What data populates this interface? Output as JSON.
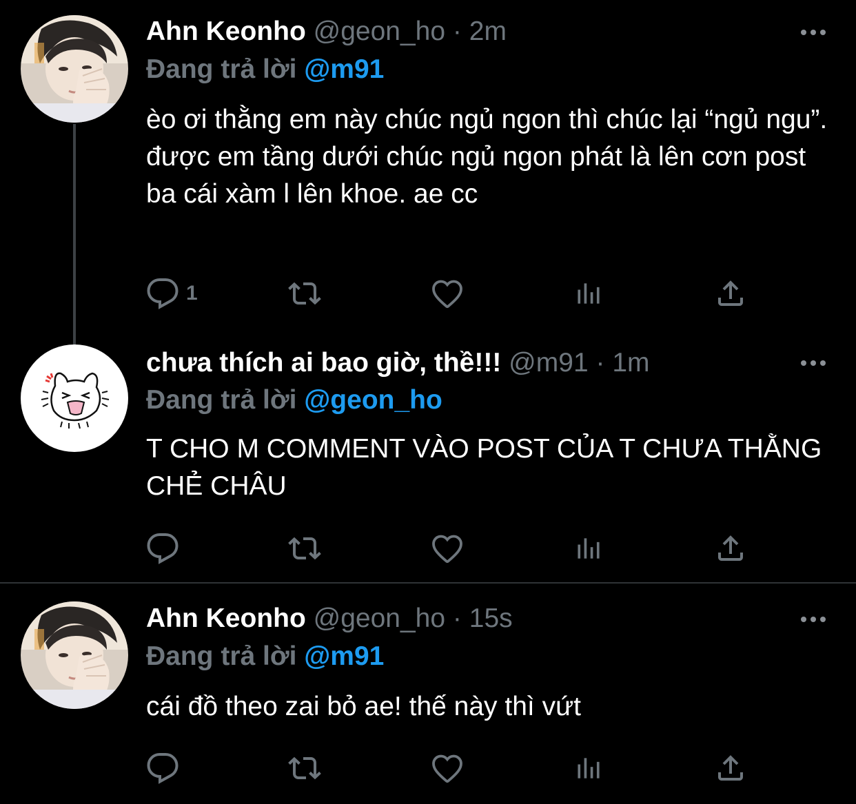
{
  "reply_prefix": "Đang trả lời",
  "dot": "·",
  "colors": {
    "background": "#000000",
    "text": "#ffffff",
    "muted": "#6e767d",
    "link": "#1d9bf0",
    "thread_line": "#3d4145"
  },
  "tweets": [
    {
      "name": "Ahn Keonho",
      "handle": "@geon_ho",
      "time": "2m",
      "reply_to": "@m91",
      "text": "èo ơi thằng em này chúc ngủ ngon thì chúc lại “ngủ ngu”. được em tầng dưới chúc ngủ ngon phát là lên cơn post ba cái xàm l lên khoe. ae cc",
      "reply_count": "1",
      "avatar": "photo-avatar"
    },
    {
      "name": "chưa thích ai bao giờ, thề!!!",
      "handle": "@m91",
      "time": "1m",
      "reply_to": "@geon_ho",
      "text": "T CHO M COMMENT VÀO POST CỦA T CHƯA THẰNG CHẺ CHÂU",
      "reply_count": "",
      "avatar": "angry-cat-doodle-avatar"
    },
    {
      "name": "Ahn Keonho",
      "handle": "@geon_ho",
      "time": "15s",
      "reply_to": "@m91",
      "text": "cái đồ theo zai bỏ ae! thế này thì vứt",
      "reply_count": "",
      "avatar": "photo-avatar"
    }
  ],
  "icons": {
    "more": "more-dots-icon",
    "reply": "reply-bubble-icon",
    "retweet": "retweet-icon",
    "like": "heart-icon",
    "analytics": "analytics-bars-icon",
    "share": "share-icon"
  }
}
